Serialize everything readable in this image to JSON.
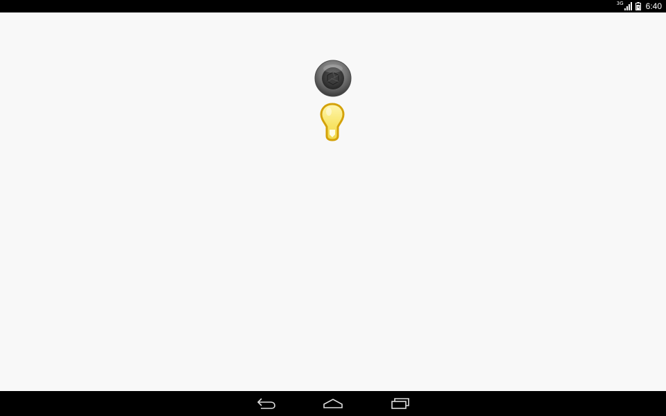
{
  "status_bar": {
    "network_type": "3G",
    "time": "6:40",
    "icons": [
      "signal-icon",
      "battery-icon"
    ]
  },
  "main": {
    "buttons": [
      {
        "name": "camera-shutter-button",
        "icon": "camera-aperture-icon"
      },
      {
        "name": "flashlight-button",
        "icon": "lightbulb-icon",
        "color": "#f5d94a"
      }
    ]
  },
  "nav_bar": {
    "buttons": [
      "back-icon",
      "home-icon",
      "recents-icon"
    ]
  }
}
